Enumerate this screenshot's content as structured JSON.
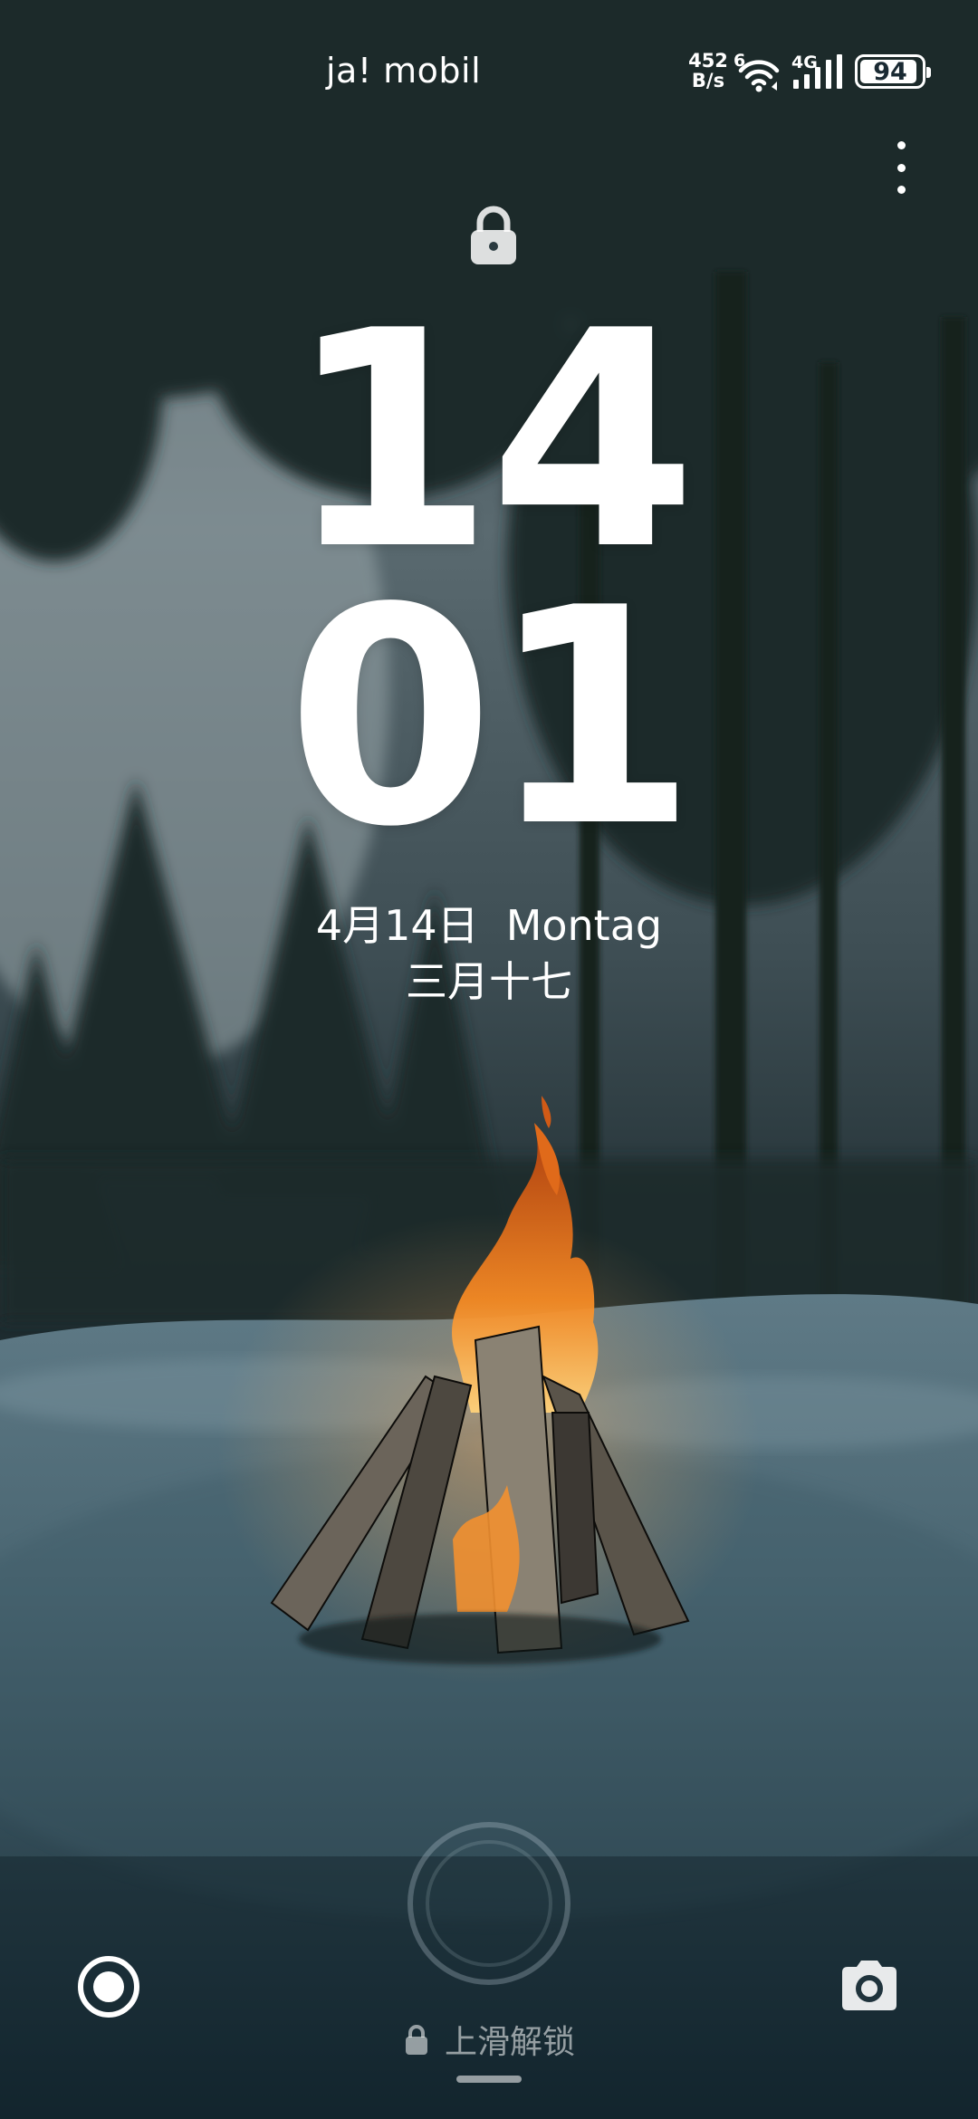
{
  "status_bar": {
    "carrier": "ja! mobil",
    "net_speed_value": "452",
    "net_speed_unit": "B/s",
    "wifi_icon": "wifi-6-icon",
    "wifi_badge": "6",
    "cell_label": "4G",
    "cell_icon": "signal-bars-icon",
    "battery_level": "94",
    "battery_fraction": 0.94
  },
  "lock_screen": {
    "clock_hours": "14",
    "clock_minutes": "01",
    "date": "4月14日",
    "weekday": "Montag",
    "lunar_date": "三月十七",
    "more_icon": "more-vertical-icon",
    "lock_icon": "lock-icon"
  },
  "bottom_bar": {
    "left_shortcut_icon": "assistant-icon",
    "right_shortcut_icon": "camera-icon",
    "fingerprint_icon": "fingerprint-ring-icon",
    "swipe_hint": "上滑解锁"
  },
  "colors": {
    "text": "#ffffff",
    "flame": "#f07a1e"
  }
}
